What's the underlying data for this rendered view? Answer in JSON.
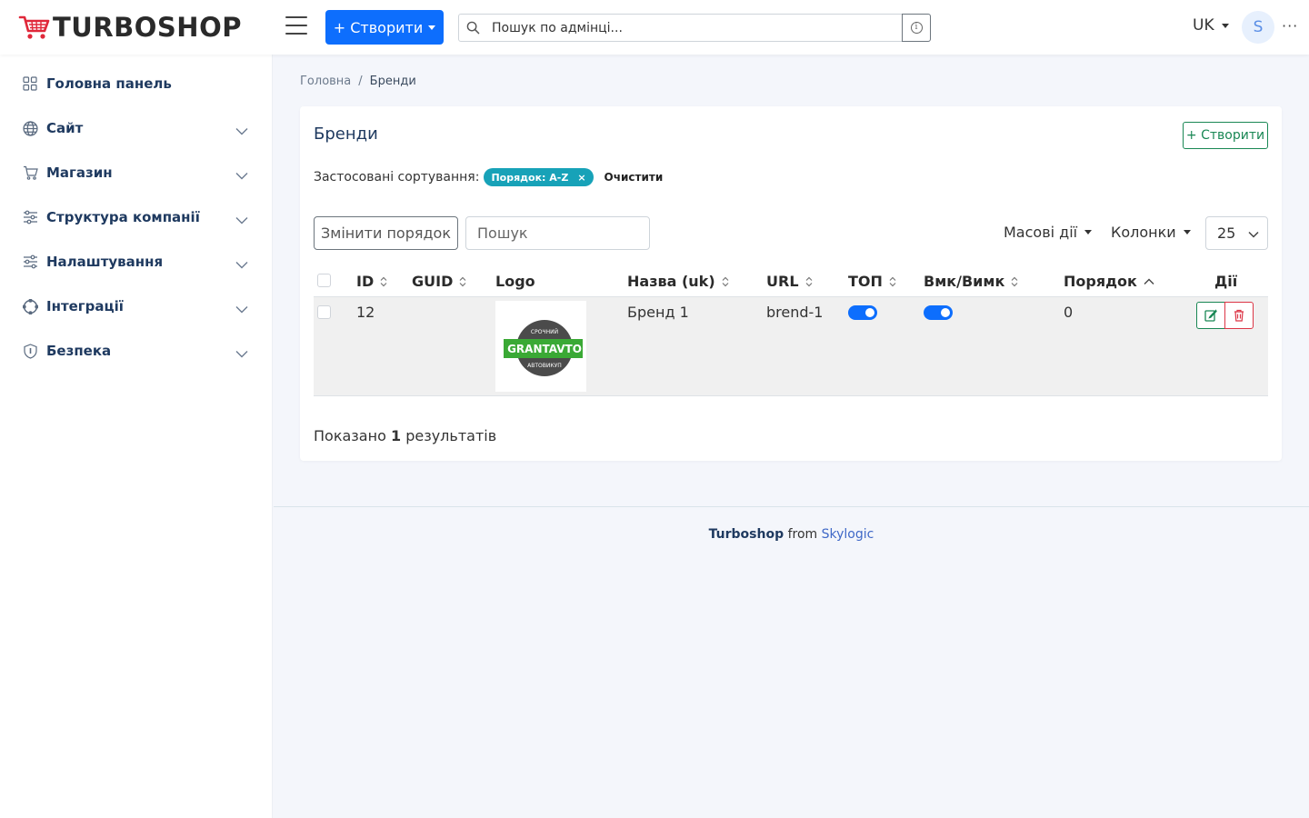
{
  "header": {
    "logo_text": "TURBOSHOP",
    "create_label": "+ Створити",
    "search_placeholder": "Пошук по адмінці...",
    "info_glyph": "i",
    "language": "UK",
    "avatar_letter": "S",
    "more_glyph": "···",
    "brand_color": "#e0283a"
  },
  "sidebar": {
    "items": [
      {
        "label": "Головна панель",
        "icon": "dashboard-icon"
      },
      {
        "label": "Сайт",
        "icon": "globe-icon"
      },
      {
        "label": "Магазин",
        "icon": "cart-icon"
      },
      {
        "label": "Структура компанії",
        "icon": "sliders-icon"
      },
      {
        "label": "Налаштування",
        "icon": "settings-sliders-icon"
      },
      {
        "label": "Інтеграції",
        "icon": "integrations-icon"
      },
      {
        "label": "Безпека",
        "icon": "shield-icon"
      }
    ]
  },
  "breadcrumb": {
    "home": "Головна",
    "separator": "/",
    "current": "Бренди"
  },
  "card": {
    "title": "Бренди",
    "create_label": "+ Створити",
    "sorts_label": "Застосовані сортування:",
    "sort_chip": "Порядок: A-Z",
    "sort_chip_close": "×",
    "clear_label": "Очистити",
    "reorder_label": "Змінити порядок",
    "search_placeholder": "Пошук",
    "mass_actions_label": "Масові дії",
    "columns_label": "Колонки",
    "per_page": "25"
  },
  "table": {
    "columns": [
      "ID",
      "GUID",
      "Logo",
      "Назва (uk)",
      "URL",
      "ТОП",
      "Вмк/Вимк",
      "Порядок",
      "Дії"
    ],
    "rows": [
      {
        "id": "12",
        "guid": "",
        "name": "Бренд 1",
        "url": "brend-1",
        "top": true,
        "enabled": true,
        "order": "0",
        "logo": {
          "top": "СРОЧНИЙ",
          "middle": "GRANTAVTO",
          "bottom": "АВТОВИКУП"
        }
      }
    ]
  },
  "results": {
    "prefix": "Показано",
    "count": "1",
    "suffix": "результатів"
  },
  "footer": {
    "brand": "Turboshop",
    "middle": "from",
    "vendor": "Skylogic"
  }
}
